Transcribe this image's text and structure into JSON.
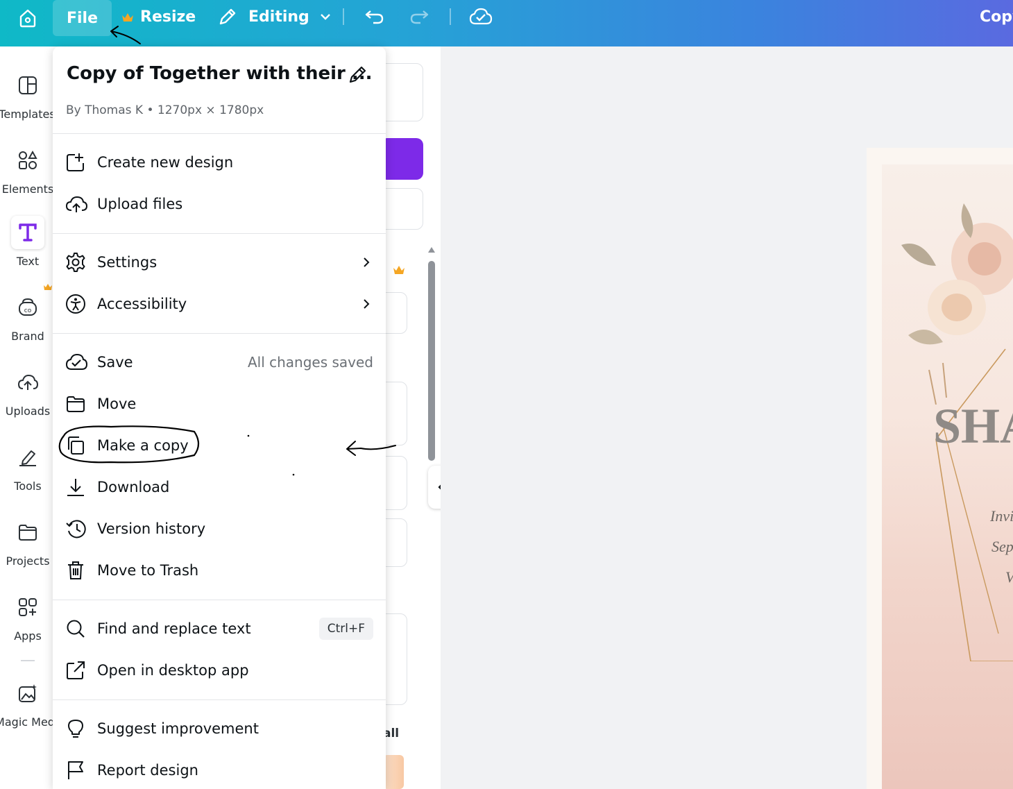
{
  "topbar": {
    "file_label": "File",
    "resize_label": "Resize",
    "editing_label": "Editing",
    "copy_label": "Copy"
  },
  "sidebar": {
    "items": [
      {
        "label": "Templates",
        "icon": "templates-icon"
      },
      {
        "label": "Elements",
        "icon": "elements-icon"
      },
      {
        "label": "Text",
        "icon": "text-icon"
      },
      {
        "label": "Brand",
        "icon": "brand-icon"
      },
      {
        "label": "Uploads",
        "icon": "uploads-icon"
      },
      {
        "label": "Tools",
        "icon": "tools-icon"
      },
      {
        "label": "Projects",
        "icon": "projects-icon"
      },
      {
        "label": "Apps",
        "icon": "apps-icon"
      },
      {
        "label": "Magic Med",
        "icon": "magic-media-icon"
      }
    ]
  },
  "panel": {
    "see_all": "all"
  },
  "menu": {
    "title": "Copy of Together with their ...",
    "subtitle": "By Thomas K • 1270px × 1780px",
    "items": [
      {
        "label": "Create new design",
        "icon": "create-new-design-icon"
      },
      {
        "label": "Upload files",
        "icon": "upload-cloud-icon"
      },
      {
        "label": "Settings",
        "icon": "gear-icon"
      },
      {
        "label": "Accessibility",
        "icon": "accessibility-icon"
      },
      {
        "label": "Save",
        "icon": "cloud-check-icon",
        "status": "All changes saved"
      },
      {
        "label": "Move",
        "icon": "folder-icon"
      },
      {
        "label": "Make a copy",
        "icon": "copy-icon"
      },
      {
        "label": "Download",
        "icon": "download-icon"
      },
      {
        "label": "Version history",
        "icon": "history-icon"
      },
      {
        "label": "Move to Trash",
        "icon": "trash-icon"
      },
      {
        "label": "Find and replace text",
        "icon": "search-icon",
        "shortcut": "Ctrl+F"
      },
      {
        "label": "Open in desktop app",
        "icon": "external-link-icon"
      },
      {
        "label": "Suggest improvement",
        "icon": "lightbulb-icon"
      },
      {
        "label": "Report design",
        "icon": "flag-icon"
      }
    ]
  },
  "canvas": {
    "page_title": "SHA",
    "lines": [
      "Invi",
      "Sep",
      "V"
    ]
  },
  "colors": {
    "topbar_start": "#0fb9c7",
    "topbar_end": "#5a6ae0",
    "brand_purple": "#7d2ae8",
    "crown": "#f5a623",
    "annotation": "#000000"
  }
}
